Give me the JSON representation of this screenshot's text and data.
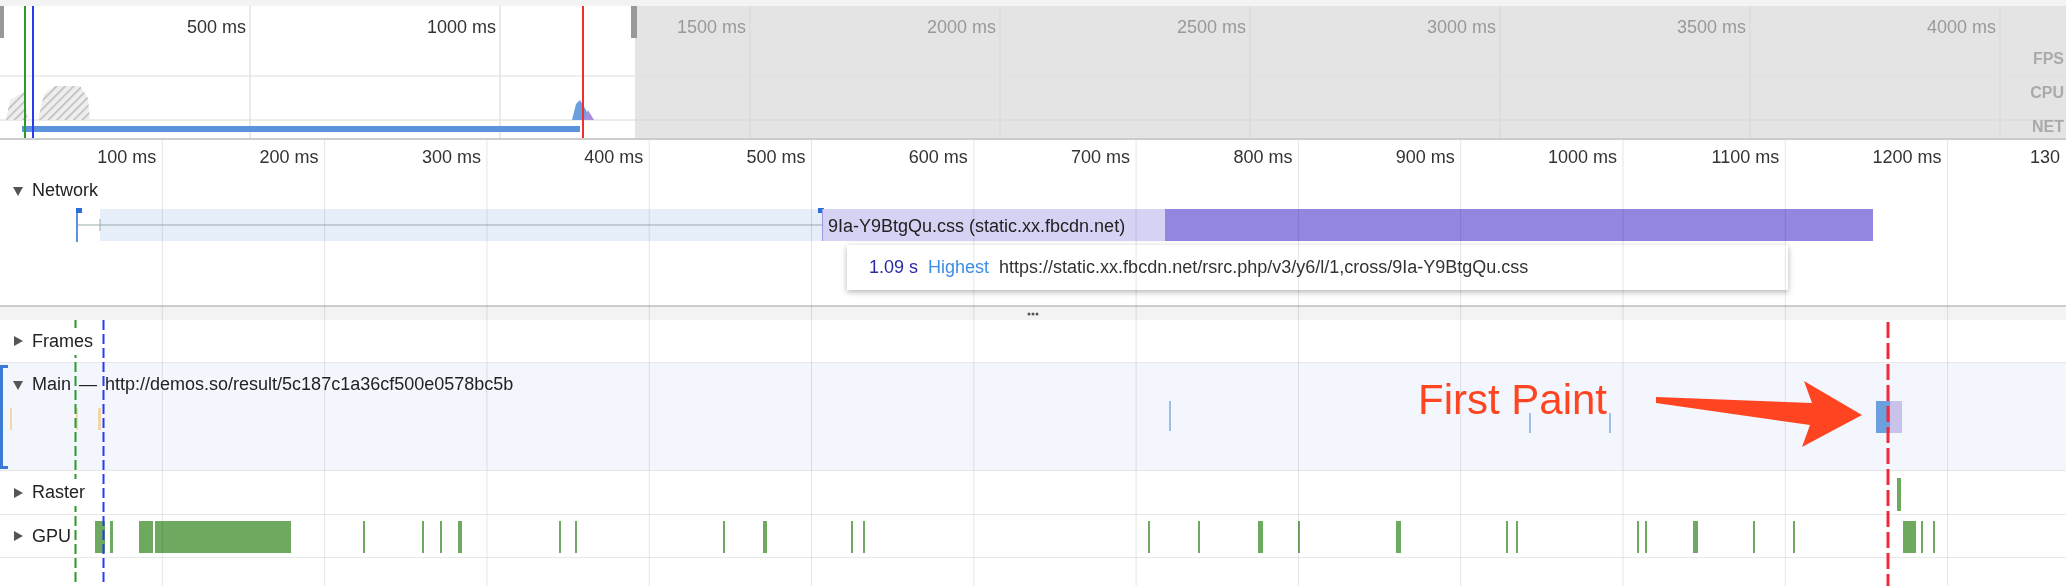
{
  "overview": {
    "ticks": [
      "500 ms",
      "1000 ms",
      "1500 ms",
      "2000 ms",
      "2500 ms",
      "3000 ms",
      "3500 ms",
      "4000 ms"
    ],
    "track_labels": [
      "FPS",
      "CPU",
      "NET"
    ]
  },
  "ruler": {
    "ticks": [
      "100 ms",
      "200 ms",
      "300 ms",
      "400 ms",
      "500 ms",
      "600 ms",
      "700 ms",
      "800 ms",
      "900 ms",
      "1000 ms",
      "1100 ms",
      "1200 ms",
      "130"
    ]
  },
  "network": {
    "title": "Network",
    "expanded": true,
    "request": {
      "label": "9Ia-Y9BtgQu.css (static.xx.fbcdn.net)"
    },
    "tooltip": {
      "duration": "1.09 s",
      "priority": "Highest",
      "url": "https://static.xx.fbcdn.net/rsrc.php/v3/y6/l/1,cross/9Ia-Y9BtgQu.css"
    }
  },
  "tracks": [
    {
      "kind": "frames",
      "name": "Frames",
      "expanded": false
    },
    {
      "kind": "main",
      "name": "Main",
      "separator": "—",
      "url": "http://demos.so/result/5c187c1a36cf500e0578bc5b",
      "expanded": true,
      "selected": true
    },
    {
      "kind": "raster",
      "name": "Raster",
      "expanded": false
    },
    {
      "kind": "gpu",
      "name": "GPU",
      "expanded": false
    }
  ],
  "annotation": {
    "text": "First Paint"
  }
}
